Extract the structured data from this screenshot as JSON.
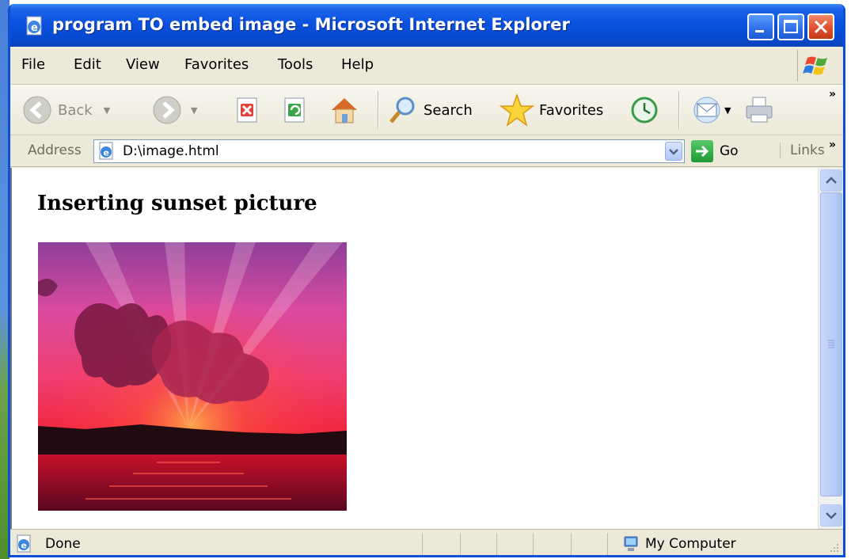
{
  "window": {
    "title": "program TO embed image - Microsoft Internet Explorer"
  },
  "menu": {
    "items": [
      "File",
      "Edit",
      "View",
      "Favorites",
      "Tools",
      "Help"
    ]
  },
  "toolbar": {
    "back_label": "Back",
    "search_label": "Search",
    "favorites_label": "Favorites",
    "overflow": "»"
  },
  "address": {
    "label": "Address",
    "url": "D:\\image.html",
    "go_label": "Go",
    "links_label": "Links",
    "overflow": "»"
  },
  "content": {
    "heading": "Inserting sunset picture"
  },
  "status": {
    "text": "Done",
    "zone": "My Computer"
  },
  "colors": {
    "titlebar": "#0a52e0",
    "chrome": "#ece9d8",
    "close_button": "#e0502e"
  }
}
